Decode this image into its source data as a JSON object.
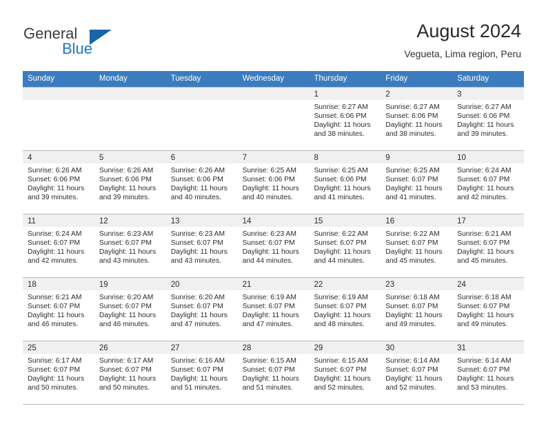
{
  "brand": {
    "name_part1": "General",
    "name_part2": "Blue",
    "accent_color": "#1b77c4",
    "triangle_color": "#1565a8"
  },
  "header": {
    "title": "August 2024",
    "subtitle": "Vegueta, Lima region, Peru"
  },
  "calendar": {
    "header_bg": "#3b7cbf",
    "weekdays": [
      "Sunday",
      "Monday",
      "Tuesday",
      "Wednesday",
      "Thursday",
      "Friday",
      "Saturday"
    ],
    "weeks": [
      [
        {
          "day": "",
          "sunrise": "",
          "sunset": "",
          "daylight_line1": "",
          "daylight_line2": "",
          "empty": true
        },
        {
          "day": "",
          "sunrise": "",
          "sunset": "",
          "daylight_line1": "",
          "daylight_line2": "",
          "empty": true
        },
        {
          "day": "",
          "sunrise": "",
          "sunset": "",
          "daylight_line1": "",
          "daylight_line2": "",
          "empty": true
        },
        {
          "day": "",
          "sunrise": "",
          "sunset": "",
          "daylight_line1": "",
          "daylight_line2": "",
          "empty": true
        },
        {
          "day": "1",
          "sunrise": "Sunrise: 6:27 AM",
          "sunset": "Sunset: 6:06 PM",
          "daylight_line1": "Daylight: 11 hours",
          "daylight_line2": "and 38 minutes."
        },
        {
          "day": "2",
          "sunrise": "Sunrise: 6:27 AM",
          "sunset": "Sunset: 6:06 PM",
          "daylight_line1": "Daylight: 11 hours",
          "daylight_line2": "and 38 minutes."
        },
        {
          "day": "3",
          "sunrise": "Sunrise: 6:27 AM",
          "sunset": "Sunset: 6:06 PM",
          "daylight_line1": "Daylight: 11 hours",
          "daylight_line2": "and 39 minutes."
        }
      ],
      [
        {
          "day": "4",
          "sunrise": "Sunrise: 6:26 AM",
          "sunset": "Sunset: 6:06 PM",
          "daylight_line1": "Daylight: 11 hours",
          "daylight_line2": "and 39 minutes."
        },
        {
          "day": "5",
          "sunrise": "Sunrise: 6:26 AM",
          "sunset": "Sunset: 6:06 PM",
          "daylight_line1": "Daylight: 11 hours",
          "daylight_line2": "and 39 minutes."
        },
        {
          "day": "6",
          "sunrise": "Sunrise: 6:26 AM",
          "sunset": "Sunset: 6:06 PM",
          "daylight_line1": "Daylight: 11 hours",
          "daylight_line2": "and 40 minutes."
        },
        {
          "day": "7",
          "sunrise": "Sunrise: 6:25 AM",
          "sunset": "Sunset: 6:06 PM",
          "daylight_line1": "Daylight: 11 hours",
          "daylight_line2": "and 40 minutes."
        },
        {
          "day": "8",
          "sunrise": "Sunrise: 6:25 AM",
          "sunset": "Sunset: 6:06 PM",
          "daylight_line1": "Daylight: 11 hours",
          "daylight_line2": "and 41 minutes."
        },
        {
          "day": "9",
          "sunrise": "Sunrise: 6:25 AM",
          "sunset": "Sunset: 6:07 PM",
          "daylight_line1": "Daylight: 11 hours",
          "daylight_line2": "and 41 minutes."
        },
        {
          "day": "10",
          "sunrise": "Sunrise: 6:24 AM",
          "sunset": "Sunset: 6:07 PM",
          "daylight_line1": "Daylight: 11 hours",
          "daylight_line2": "and 42 minutes."
        }
      ],
      [
        {
          "day": "11",
          "sunrise": "Sunrise: 6:24 AM",
          "sunset": "Sunset: 6:07 PM",
          "daylight_line1": "Daylight: 11 hours",
          "daylight_line2": "and 42 minutes."
        },
        {
          "day": "12",
          "sunrise": "Sunrise: 6:23 AM",
          "sunset": "Sunset: 6:07 PM",
          "daylight_line1": "Daylight: 11 hours",
          "daylight_line2": "and 43 minutes."
        },
        {
          "day": "13",
          "sunrise": "Sunrise: 6:23 AM",
          "sunset": "Sunset: 6:07 PM",
          "daylight_line1": "Daylight: 11 hours",
          "daylight_line2": "and 43 minutes."
        },
        {
          "day": "14",
          "sunrise": "Sunrise: 6:23 AM",
          "sunset": "Sunset: 6:07 PM",
          "daylight_line1": "Daylight: 11 hours",
          "daylight_line2": "and 44 minutes."
        },
        {
          "day": "15",
          "sunrise": "Sunrise: 6:22 AM",
          "sunset": "Sunset: 6:07 PM",
          "daylight_line1": "Daylight: 11 hours",
          "daylight_line2": "and 44 minutes."
        },
        {
          "day": "16",
          "sunrise": "Sunrise: 6:22 AM",
          "sunset": "Sunset: 6:07 PM",
          "daylight_line1": "Daylight: 11 hours",
          "daylight_line2": "and 45 minutes."
        },
        {
          "day": "17",
          "sunrise": "Sunrise: 6:21 AM",
          "sunset": "Sunset: 6:07 PM",
          "daylight_line1": "Daylight: 11 hours",
          "daylight_line2": "and 45 minutes."
        }
      ],
      [
        {
          "day": "18",
          "sunrise": "Sunrise: 6:21 AM",
          "sunset": "Sunset: 6:07 PM",
          "daylight_line1": "Daylight: 11 hours",
          "daylight_line2": "and 46 minutes."
        },
        {
          "day": "19",
          "sunrise": "Sunrise: 6:20 AM",
          "sunset": "Sunset: 6:07 PM",
          "daylight_line1": "Daylight: 11 hours",
          "daylight_line2": "and 46 minutes."
        },
        {
          "day": "20",
          "sunrise": "Sunrise: 6:20 AM",
          "sunset": "Sunset: 6:07 PM",
          "daylight_line1": "Daylight: 11 hours",
          "daylight_line2": "and 47 minutes."
        },
        {
          "day": "21",
          "sunrise": "Sunrise: 6:19 AM",
          "sunset": "Sunset: 6:07 PM",
          "daylight_line1": "Daylight: 11 hours",
          "daylight_line2": "and 47 minutes."
        },
        {
          "day": "22",
          "sunrise": "Sunrise: 6:19 AM",
          "sunset": "Sunset: 6:07 PM",
          "daylight_line1": "Daylight: 11 hours",
          "daylight_line2": "and 48 minutes."
        },
        {
          "day": "23",
          "sunrise": "Sunrise: 6:18 AM",
          "sunset": "Sunset: 6:07 PM",
          "daylight_line1": "Daylight: 11 hours",
          "daylight_line2": "and 49 minutes."
        },
        {
          "day": "24",
          "sunrise": "Sunrise: 6:18 AM",
          "sunset": "Sunset: 6:07 PM",
          "daylight_line1": "Daylight: 11 hours",
          "daylight_line2": "and 49 minutes."
        }
      ],
      [
        {
          "day": "25",
          "sunrise": "Sunrise: 6:17 AM",
          "sunset": "Sunset: 6:07 PM",
          "daylight_line1": "Daylight: 11 hours",
          "daylight_line2": "and 50 minutes."
        },
        {
          "day": "26",
          "sunrise": "Sunrise: 6:17 AM",
          "sunset": "Sunset: 6:07 PM",
          "daylight_line1": "Daylight: 11 hours",
          "daylight_line2": "and 50 minutes."
        },
        {
          "day": "27",
          "sunrise": "Sunrise: 6:16 AM",
          "sunset": "Sunset: 6:07 PM",
          "daylight_line1": "Daylight: 11 hours",
          "daylight_line2": "and 51 minutes."
        },
        {
          "day": "28",
          "sunrise": "Sunrise: 6:15 AM",
          "sunset": "Sunset: 6:07 PM",
          "daylight_line1": "Daylight: 11 hours",
          "daylight_line2": "and 51 minutes."
        },
        {
          "day": "29",
          "sunrise": "Sunrise: 6:15 AM",
          "sunset": "Sunset: 6:07 PM",
          "daylight_line1": "Daylight: 11 hours",
          "daylight_line2": "and 52 minutes."
        },
        {
          "day": "30",
          "sunrise": "Sunrise: 6:14 AM",
          "sunset": "Sunset: 6:07 PM",
          "daylight_line1": "Daylight: 11 hours",
          "daylight_line2": "and 52 minutes."
        },
        {
          "day": "31",
          "sunrise": "Sunrise: 6:14 AM",
          "sunset": "Sunset: 6:07 PM",
          "daylight_line1": "Daylight: 11 hours",
          "daylight_line2": "and 53 minutes."
        }
      ]
    ]
  }
}
